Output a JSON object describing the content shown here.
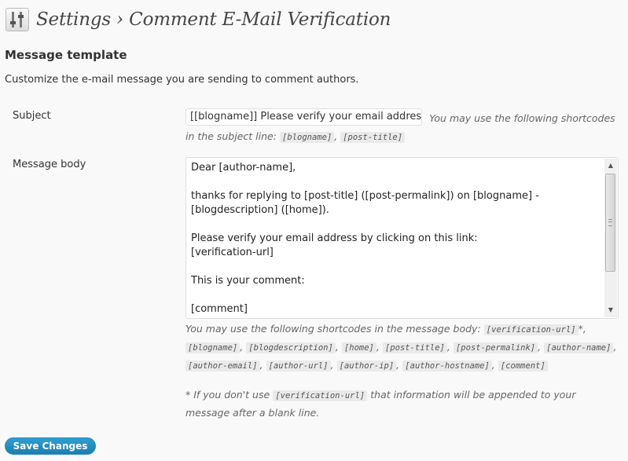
{
  "header": {
    "icon": "settings-sliders-icon",
    "title": "Settings › Comment E-Mail Verification"
  },
  "section": {
    "title": "Message template",
    "description": "Customize the e-mail message you are sending to comment authors."
  },
  "subject": {
    "label": "Subject",
    "value": "[[blogname]] Please verify your email address",
    "hint_prefix": "You may use the following shortcodes in the subject line:",
    "codes": [
      "[blogname]",
      "[post-title]"
    ]
  },
  "body": {
    "label": "Message body",
    "value": "Dear [author-name],\n\nthanks for replying to [post-title] ([post-permalink]) on [blogname] - [blogdescription] ([home]).\n\nPlease verify your email address by clicking on this link:\n[verification-url]\n\nThis is your comment:\n\n[comment]",
    "hint_prefix": "You may use the following shortcodes in the message body:",
    "codes": [
      "[verification-url]",
      "[blogname]",
      "[blogdescription]",
      "[home]",
      "[post-title]",
      "[post-permalink]",
      "[author-name]",
      "[author-email]",
      "[author-url]",
      "[author-ip]",
      "[author-hostname]",
      "[comment]"
    ],
    "footnote_prefix": "* If you don't use",
    "footnote_code": "[verification-url]",
    "footnote_suffix": "that information will be appended to your message after a blank line."
  },
  "save_button": {
    "label": "Save Changes",
    "color": "#21759b"
  }
}
